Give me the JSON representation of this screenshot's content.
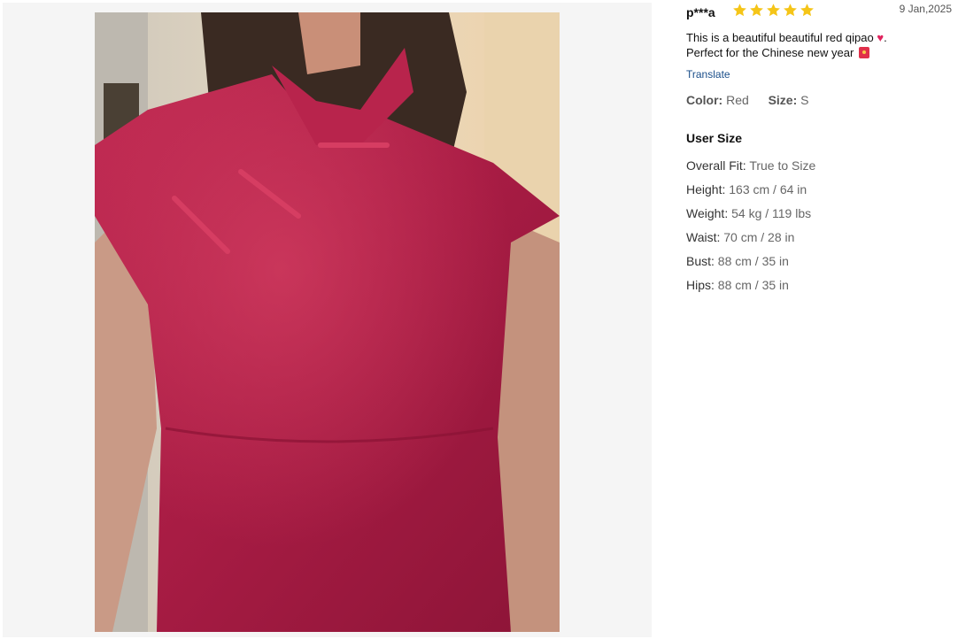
{
  "review": {
    "reviewer": "p***a",
    "rating": 5,
    "rating_max": 5,
    "date": "9 Jan,2025",
    "text_line1": "This is a beautiful beautiful red qipao ",
    "text_line1_end": ".",
    "text_line2": "Perfect for the Chinese new year ",
    "heart_icon": "heart-icon",
    "envelope_icon": "red-envelope-icon",
    "translate_label": "Translate",
    "color_label": "Color:",
    "color_value": "Red",
    "size_label": "Size:",
    "size_value": "S"
  },
  "user_size": {
    "title": "User Size",
    "rows": [
      {
        "label": "Overall Fit:",
        "value": "True to Size"
      },
      {
        "label": "Height:",
        "value": "163 cm / 64 in"
      },
      {
        "label": "Weight:",
        "value": "54 kg / 119 lbs"
      },
      {
        "label": "Waist:",
        "value": "70 cm / 28 in"
      },
      {
        "label": "Bust:",
        "value": "88 cm / 35 in"
      },
      {
        "label": "Hips:",
        "value": "88 cm / 35 in"
      }
    ]
  },
  "colors": {
    "star": "#F5C518",
    "link": "#1A4E8A",
    "dress": "#B01F48"
  }
}
